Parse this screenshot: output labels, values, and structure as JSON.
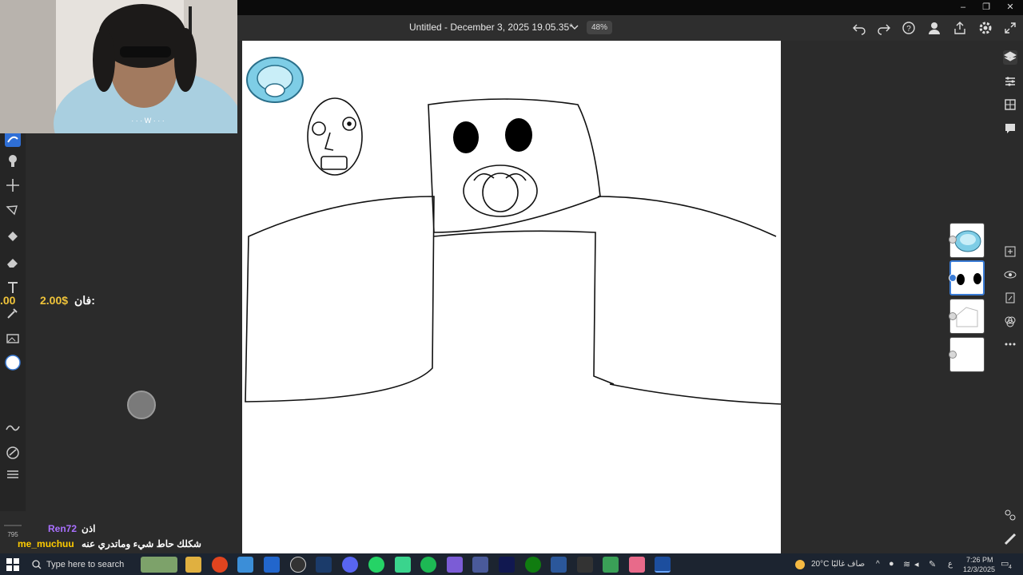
{
  "window": {
    "title": "Untitled - December 3, 2025 19.05.35*",
    "zoom": "48%"
  },
  "window_controls": {
    "minimize": "–",
    "maximize": "❐",
    "close": "✕"
  },
  "tools": {
    "active": "smudge-tool",
    "brush_size": "795"
  },
  "overlay": {
    "donation_left_amount": ".00",
    "donation_amount": "2.00$",
    "donation_label": "فان:",
    "chat": [
      {
        "user": "Ren72",
        "message": "اذن",
        "color": "#a970ff"
      },
      {
        "user": "me_muchuu",
        "message": "شكلك حاط شيء وماتدري عنه",
        "color": "#ffcc00"
      }
    ]
  },
  "layers": [
    {
      "name": "pacifier-layer",
      "visible": true
    },
    {
      "name": "eyes-layer",
      "visible": true,
      "selected": true
    },
    {
      "name": "sketch-layer",
      "visible": true
    },
    {
      "name": "background-layer",
      "visible": true
    }
  ],
  "taskbar": {
    "search_placeholder": "Type here to search",
    "weather_temp": "20°C",
    "weather_desc": "صاف غالبًا",
    "lang": "ع",
    "time": "7:26 PM",
    "date": "12/3/2025",
    "notifications": "4"
  },
  "colors": {
    "accent": "#2f6fd6",
    "taskbar": "#1c2430",
    "panel": "#2b2b2b"
  }
}
